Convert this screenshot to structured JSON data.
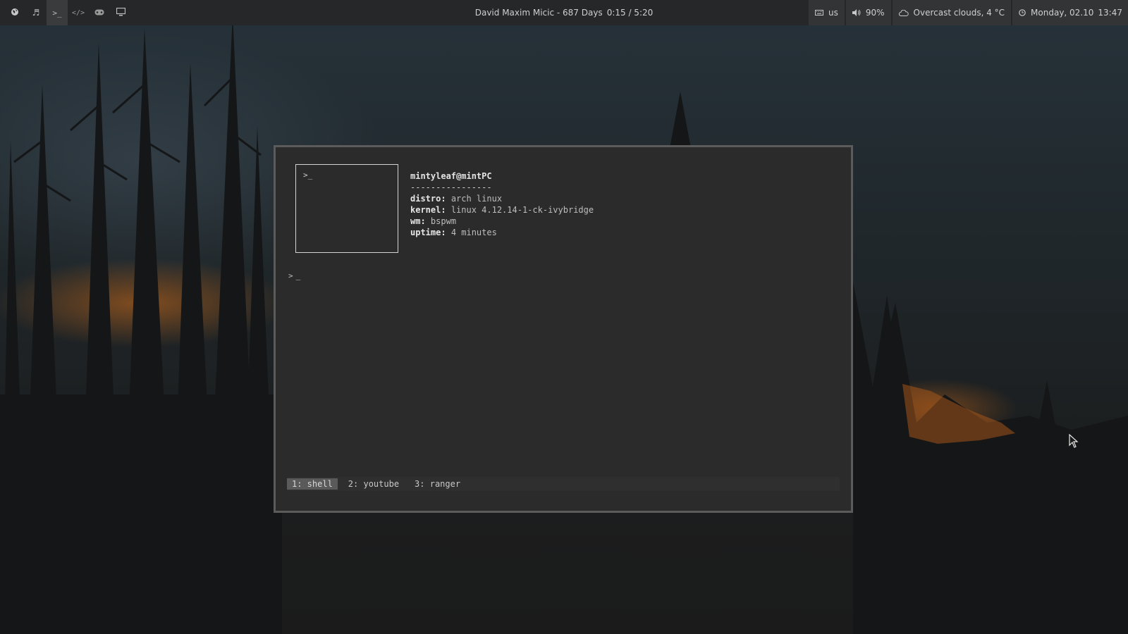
{
  "topbar": {
    "workspaces": [
      {
        "icon": "globe-icon",
        "active": false
      },
      {
        "icon": "music-note-icon",
        "active": false
      },
      {
        "icon": "terminal-icon",
        "active": true
      },
      {
        "icon": "code-icon",
        "active": false
      },
      {
        "icon": "gamepad-icon",
        "active": false
      },
      {
        "icon": "monitor-icon",
        "active": false
      }
    ],
    "now_playing": {
      "title": "David Maxim Micic - 687 Days",
      "time": "0:15 / 5:20"
    },
    "keyboard": {
      "icon": "keyboard-icon",
      "layout": "us"
    },
    "volume": {
      "icon": "speaker-icon",
      "level": "90%"
    },
    "weather": {
      "icon": "cloud-icon",
      "text": "Overcast clouds, 4 °C"
    },
    "clock": {
      "icon": "clock-icon",
      "date": "Monday, 02.10",
      "time": "13:47"
    }
  },
  "terminal": {
    "logo_glyph": ">_",
    "user": "mintyleaf@mintPC",
    "separator": "----------------",
    "info": [
      {
        "key": "distro:",
        "value": "arch linux"
      },
      {
        "key": "kernel:",
        "value": "linux 4.12.14-1-ck-ivybridge"
      },
      {
        "key": "wm:",
        "value": "bspwm"
      },
      {
        "key": "uptime:",
        "value": "4 minutes"
      }
    ],
    "prompt": ">",
    "cursor": "_",
    "tabs": [
      {
        "label": "1: shell",
        "active": true
      },
      {
        "label": "2: youtube",
        "active": false
      },
      {
        "label": "3: ranger",
        "active": false
      }
    ]
  },
  "colors": {
    "bar_bg": "#262728",
    "module_bg": "#333435",
    "terminal_bg": "#2b2b2c",
    "terminal_border": "#5b5b5b",
    "active_tab": "#5a5a5a",
    "fire_glow": "#d2741a"
  }
}
